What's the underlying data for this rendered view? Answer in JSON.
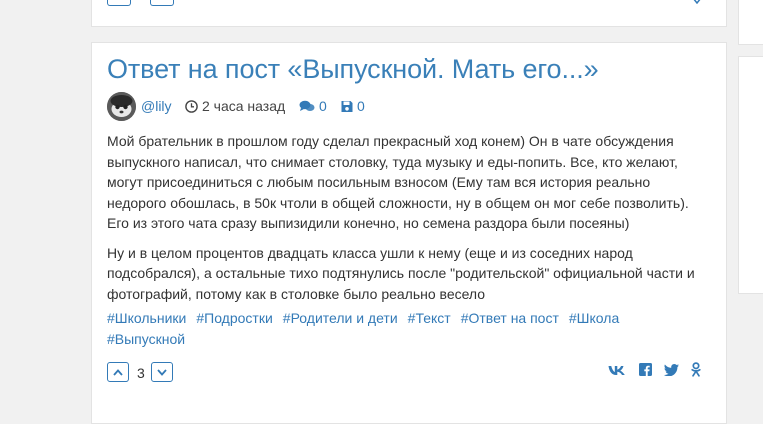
{
  "post": {
    "title": "Ответ на пост «Выпускной. Мать его...»",
    "author": "@lily",
    "time": "2 часа назад",
    "comments": "0",
    "saves": "0",
    "paragraphs": [
      "Мой брательник в прошлом году сделал прекрасный ход конем) Он в чате обсуждения",
      "выпускного написал, что снимает столовку, туда музыку и еды-попить. Все, кто желают,",
      "могут присоединиться с любым посильным взносом (Ему там вся история реально",
      "недорого обошлась, в 50к чтоли в общей сложности, ну в общем он мог себе позволить).",
      "Его из этого чата сразу выпизидили конечно, но семена раздора были посеяны)",
      "Ну и в целом процентов двадцать класса ушли к нему (еще и из соседних народ",
      "подсобрался), а остальные тихо подтянулись после \"родительской\" официальной части и",
      "фотографий, потому как в столовке было реально весело"
    ],
    "tags": [
      "#Школьники",
      "#Подростки",
      "#Родители и дети",
      "#Текст",
      "#Ответ на пост",
      "#Школа",
      "#Выпускной"
    ],
    "rating": "3"
  },
  "icons": {
    "clock": "clock-icon",
    "comments": "comments-icon",
    "save": "floppy-icon",
    "upvote": "chevron-up-icon",
    "downvote": "chevron-down-icon",
    "vk": "vk-icon",
    "facebook": "facebook-icon",
    "twitter": "twitter-icon",
    "odnoklassniki": "odnoklassniki-icon"
  },
  "colors": {
    "accent": "#337ab7",
    "title": "#3a80b8",
    "text": "#333333",
    "background": "#f1f1f1"
  }
}
